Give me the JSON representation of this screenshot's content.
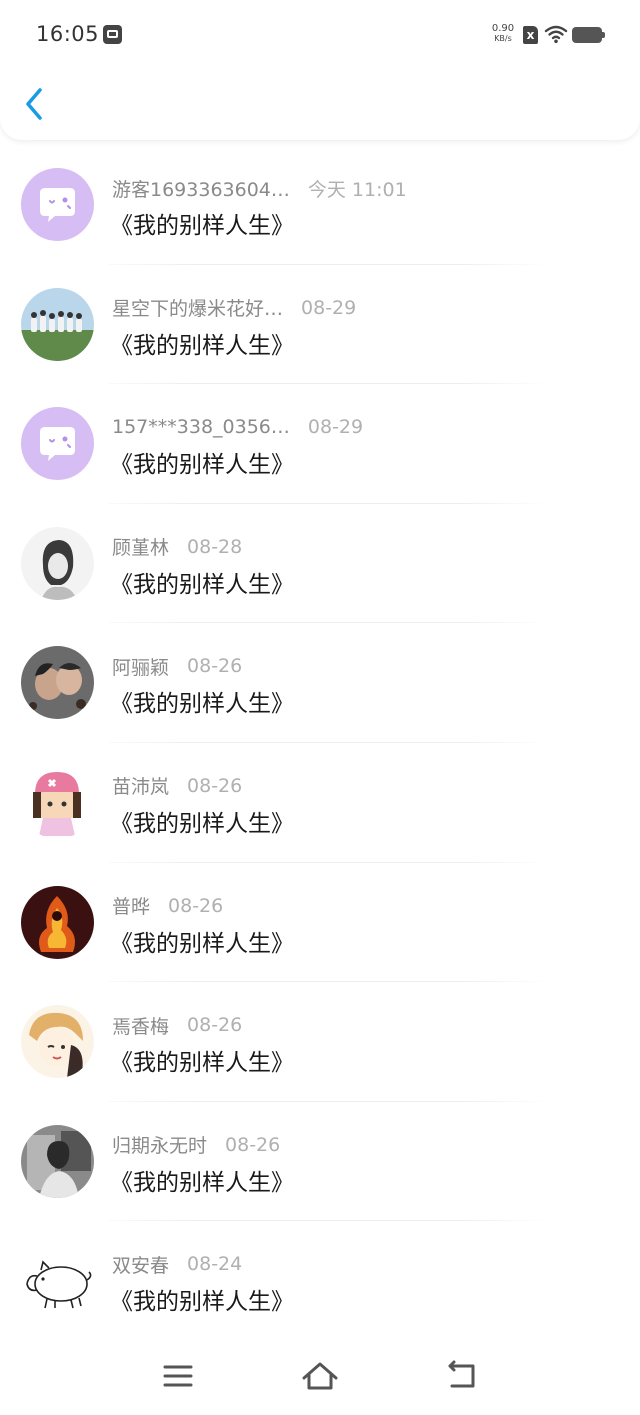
{
  "status_bar": {
    "time": "16:05",
    "net_speed_value": "0.90",
    "net_speed_unit": "KB/s",
    "sim_label": "x"
  },
  "icons": {
    "back": "chevron-left-icon",
    "menu": "menu-icon",
    "home": "home-icon",
    "return": "return-icon",
    "wifi": "wifi-icon",
    "battery": "battery-icon"
  },
  "colors": {
    "accent": "#1a9be6",
    "default_avatar_bg": "#d4b8f2"
  },
  "items": [
    {
      "name": "游客1693363604…",
      "time": "今天 11:01",
      "title": "《我的别样人生》",
      "avatar": "default-bubble"
    },
    {
      "name": "星空下的爆米花好…",
      "time": "08-29",
      "title": "《我的别样人生》",
      "avatar": "group-photo"
    },
    {
      "name": "157***338_0356…",
      "time": "08-29",
      "title": "《我的别样人生》",
      "avatar": "default-bubble"
    },
    {
      "name": "顾堇林",
      "time": "08-28",
      "title": "《我的别样人生》",
      "avatar": "sketch-portrait"
    },
    {
      "name": "阿骊颖",
      "time": "08-26",
      "title": "《我的别样人生》",
      "avatar": "couple-photo"
    },
    {
      "name": "苗沛岚",
      "time": "08-26",
      "title": "《我的别样人生》",
      "avatar": "cartoon-girl"
    },
    {
      "name": "普晔",
      "time": "08-26",
      "title": "《我的别样人生》",
      "avatar": "fire-figure"
    },
    {
      "name": "焉香梅",
      "time": "08-26",
      "title": "《我的别样人生》",
      "avatar": "anime-boy"
    },
    {
      "name": "归期永无时",
      "time": "08-26",
      "title": "《我的别样人生》",
      "avatar": "bw-photo"
    },
    {
      "name": "双安春",
      "time": "08-24",
      "title": "《我的别样人生》",
      "avatar": "pig-drawing"
    }
  ]
}
